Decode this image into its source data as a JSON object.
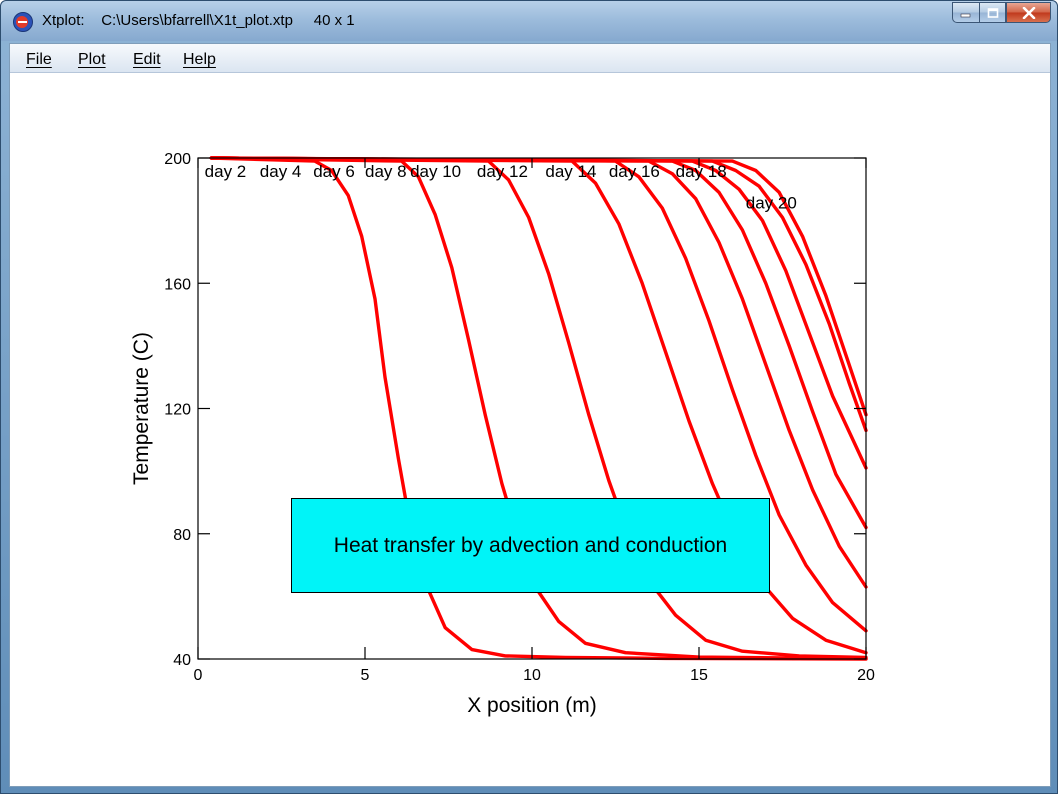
{
  "window": {
    "app_name": "Xtplot:",
    "file_path": "C:\\Users\\bfarrell\\X1t_plot.xtp",
    "dimensions": "40 x 1",
    "title_text": "Xtplot:    C:\\Users\\bfarrell\\X1t_plot.xtp     40 x 1",
    "app_icon": "xtplot-app-icon",
    "controls": {
      "minimize_icon": "minimize-icon",
      "maximize_icon": "maximize-icon",
      "close_icon": "close-icon"
    }
  },
  "menu": {
    "items": [
      {
        "label": "File"
      },
      {
        "label": "Plot"
      },
      {
        "label": "Edit"
      },
      {
        "label": "Help"
      }
    ]
  },
  "annotation": {
    "text": "Heat transfer by advection and conduction",
    "background": "#00f4f8"
  },
  "chart_data": {
    "type": "line",
    "xlabel": "X position (m)",
    "ylabel": "Temperature (C)",
    "xlim": [
      0,
      20
    ],
    "ylim": [
      40,
      200
    ],
    "xticks": [
      "0",
      "5",
      "10",
      "15",
      "20"
    ],
    "yticks": [
      "40",
      "80",
      "120",
      "160",
      "200"
    ],
    "grid": false,
    "line_color": "#ff0000",
    "series": [
      {
        "name": "day 2",
        "x": [
          0.4,
          3.5,
          4.0,
          4.5,
          4.9,
          5.3,
          5.6,
          6.0,
          6.4,
          6.9,
          7.4,
          8.2,
          9.2,
          11,
          14,
          20
        ],
        "y": [
          200,
          199,
          196,
          188,
          175,
          155,
          130,
          104,
          80,
          62,
          50,
          43,
          41,
          40.5,
          40.2,
          40
        ]
      },
      {
        "name": "day 4",
        "x": [
          0.4,
          6.1,
          6.6,
          7.1,
          7.6,
          8.1,
          8.6,
          9.1,
          9.6,
          10.1,
          10.8,
          11.6,
          12.8,
          15,
          20
        ],
        "y": [
          200,
          199,
          194,
          182,
          165,
          142,
          118,
          96,
          78,
          63,
          52,
          45,
          42,
          40.6,
          40.1
        ]
      },
      {
        "name": "day 6",
        "x": [
          0.4,
          8.7,
          9.3,
          9.9,
          10.5,
          11.1,
          11.7,
          12.3,
          12.9,
          13.5,
          14.3,
          15.2,
          16.3,
          18,
          20
        ],
        "y": [
          200,
          199,
          193,
          181,
          163,
          141,
          118,
          97,
          79,
          65,
          54,
          46,
          42.5,
          41,
          40.5
        ]
      },
      {
        "name": "day 8",
        "x": [
          0.4,
          11.2,
          11.9,
          12.6,
          13.3,
          14.0,
          14.7,
          15.4,
          16.1,
          16.9,
          17.8,
          18.8,
          20
        ],
        "y": [
          200,
          199,
          192,
          179,
          160,
          138,
          116,
          96,
          79,
          64,
          53,
          46,
          42
        ]
      },
      {
        "name": "day 10",
        "x": [
          0.4,
          12.5,
          13.2,
          13.9,
          14.6,
          15.3,
          16.0,
          16.7,
          17.4,
          18.2,
          19.0,
          20
        ],
        "y": [
          200,
          199,
          194,
          184,
          168,
          148,
          126,
          105,
          86,
          70,
          58,
          49
        ]
      },
      {
        "name": "day 12",
        "x": [
          0.4,
          13.5,
          14.2,
          14.9,
          15.6,
          16.3,
          17.0,
          17.7,
          18.4,
          19.2,
          20
        ],
        "y": [
          200,
          199,
          195,
          187,
          173,
          155,
          134,
          113,
          94,
          76,
          63
        ]
      },
      {
        "name": "day 14",
        "x": [
          0.4,
          14.2,
          14.9,
          15.6,
          16.3,
          17.0,
          17.7,
          18.4,
          19.1,
          20
        ],
        "y": [
          200,
          199,
          196,
          189,
          177,
          160,
          140,
          119,
          99,
          82
        ]
      },
      {
        "name": "day 16",
        "x": [
          0.4,
          14.8,
          15.5,
          16.2,
          16.9,
          17.6,
          18.3,
          19.0,
          20
        ],
        "y": [
          200,
          199,
          196,
          190,
          180,
          164,
          144,
          124,
          101
        ]
      },
      {
        "name": "day 18",
        "x": [
          0.4,
          15.4,
          16.1,
          16.8,
          17.5,
          18.2,
          18.9,
          19.5,
          20
        ],
        "y": [
          200,
          199,
          196,
          191,
          181,
          166,
          147,
          128,
          113
        ]
      },
      {
        "name": "day 20",
        "x": [
          0.4,
          16.0,
          16.7,
          17.4,
          18.1,
          18.8,
          19.4,
          20
        ],
        "y": [
          200,
          199,
          196,
          189,
          175,
          156,
          137,
          118
        ]
      }
    ],
    "annotations": [
      {
        "text": "day 2",
        "x": 0.2,
        "y": 195.5
      },
      {
        "text": "day 4",
        "x": 1.85,
        "y": 195.5
      },
      {
        "text": "day 6",
        "x": 3.45,
        "y": 195.5
      },
      {
        "text": "day 8",
        "x": 5.0,
        "y": 195.5
      },
      {
        "text": "day 10",
        "x": 6.35,
        "y": 195.5
      },
      {
        "text": "day 12",
        "x": 8.35,
        "y": 195.5
      },
      {
        "text": "day 14",
        "x": 10.4,
        "y": 195.5
      },
      {
        "text": "day 16",
        "x": 12.3,
        "y": 195.5
      },
      {
        "text": "day 18",
        "x": 14.3,
        "y": 195.5
      },
      {
        "text": "day 20",
        "x": 16.4,
        "y": 185.5
      }
    ]
  }
}
